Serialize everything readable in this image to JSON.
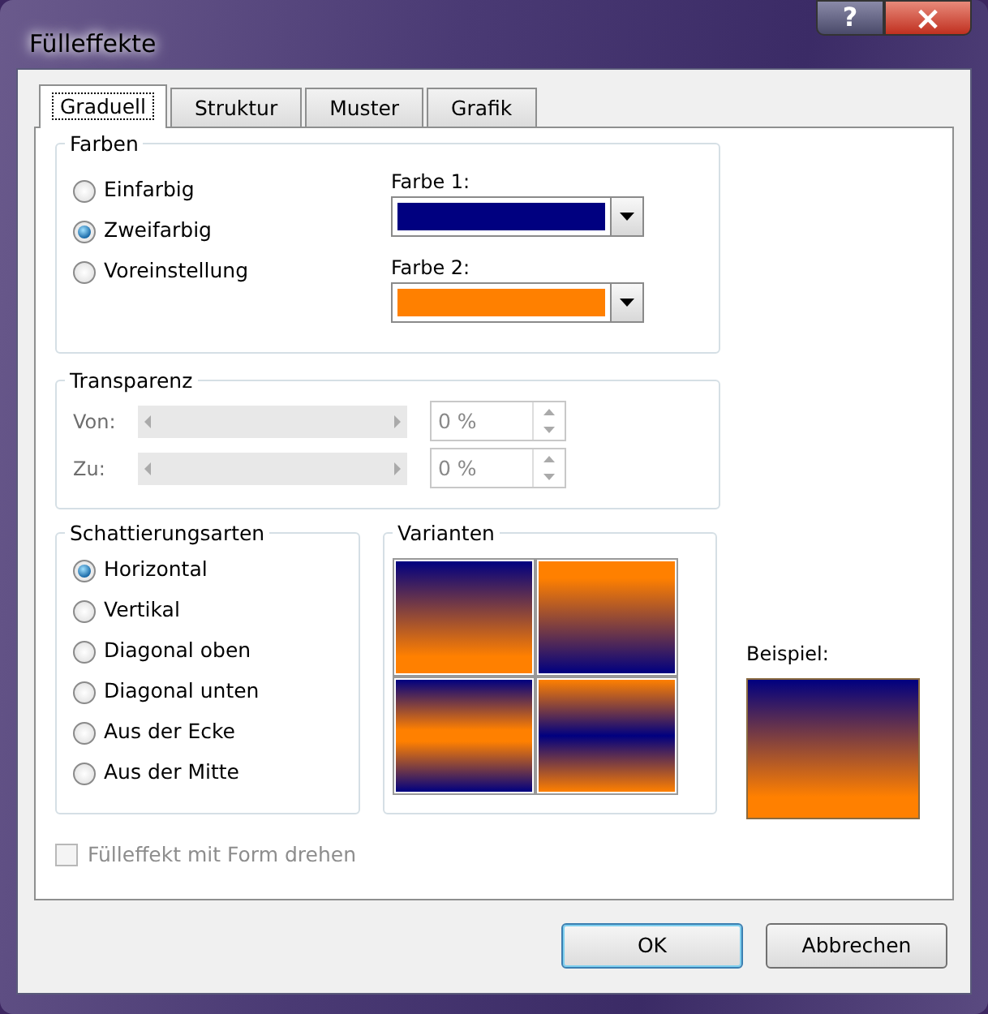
{
  "window": {
    "title": "Fülleffekte",
    "help": "?",
    "close": "×"
  },
  "tabs": [
    {
      "label": "Graduell",
      "selected": true
    },
    {
      "label": "Struktur",
      "selected": false
    },
    {
      "label": "Muster",
      "selected": false
    },
    {
      "label": "Grafik",
      "selected": false
    }
  ],
  "farben": {
    "legend": "Farben",
    "options": [
      {
        "label": "Einfarbig",
        "selected": false
      },
      {
        "label": "Zweifarbig",
        "selected": true
      },
      {
        "label": "Voreinstellung",
        "selected": false
      }
    ],
    "pickers": [
      {
        "label": "Farbe 1:",
        "color": "#000080"
      },
      {
        "label": "Farbe 2:",
        "color": "#ff8000"
      }
    ]
  },
  "transparenz": {
    "legend": "Transparenz",
    "disabled": true,
    "rows": [
      {
        "label": "Von:",
        "value": "0 %"
      },
      {
        "label": "Zu:",
        "value": "0 %"
      }
    ]
  },
  "schattierungsarten": {
    "legend": "Schattierungsarten",
    "options": [
      {
        "label": "Horizontal",
        "selected": true
      },
      {
        "label": "Vertikal",
        "selected": false
      },
      {
        "label": "Diagonal oben",
        "selected": false
      },
      {
        "label": "Diagonal unten",
        "selected": false
      },
      {
        "label": "Aus der Ecke",
        "selected": false
      },
      {
        "label": "Aus der Mitte",
        "selected": false
      }
    ]
  },
  "varianten": {
    "legend": "Varianten",
    "items": [
      {
        "kind": "down"
      },
      {
        "kind": "up"
      },
      {
        "kind": "edges"
      },
      {
        "kind": "middle"
      }
    ]
  },
  "rotate_checkbox": {
    "label": "Fülleffekt mit Form drehen",
    "checked": false,
    "disabled": true
  },
  "beispiel": {
    "label": "Beispiel:"
  },
  "buttons": [
    {
      "label": "OK",
      "default": true
    },
    {
      "label": "Abbrechen",
      "default": false
    }
  ]
}
